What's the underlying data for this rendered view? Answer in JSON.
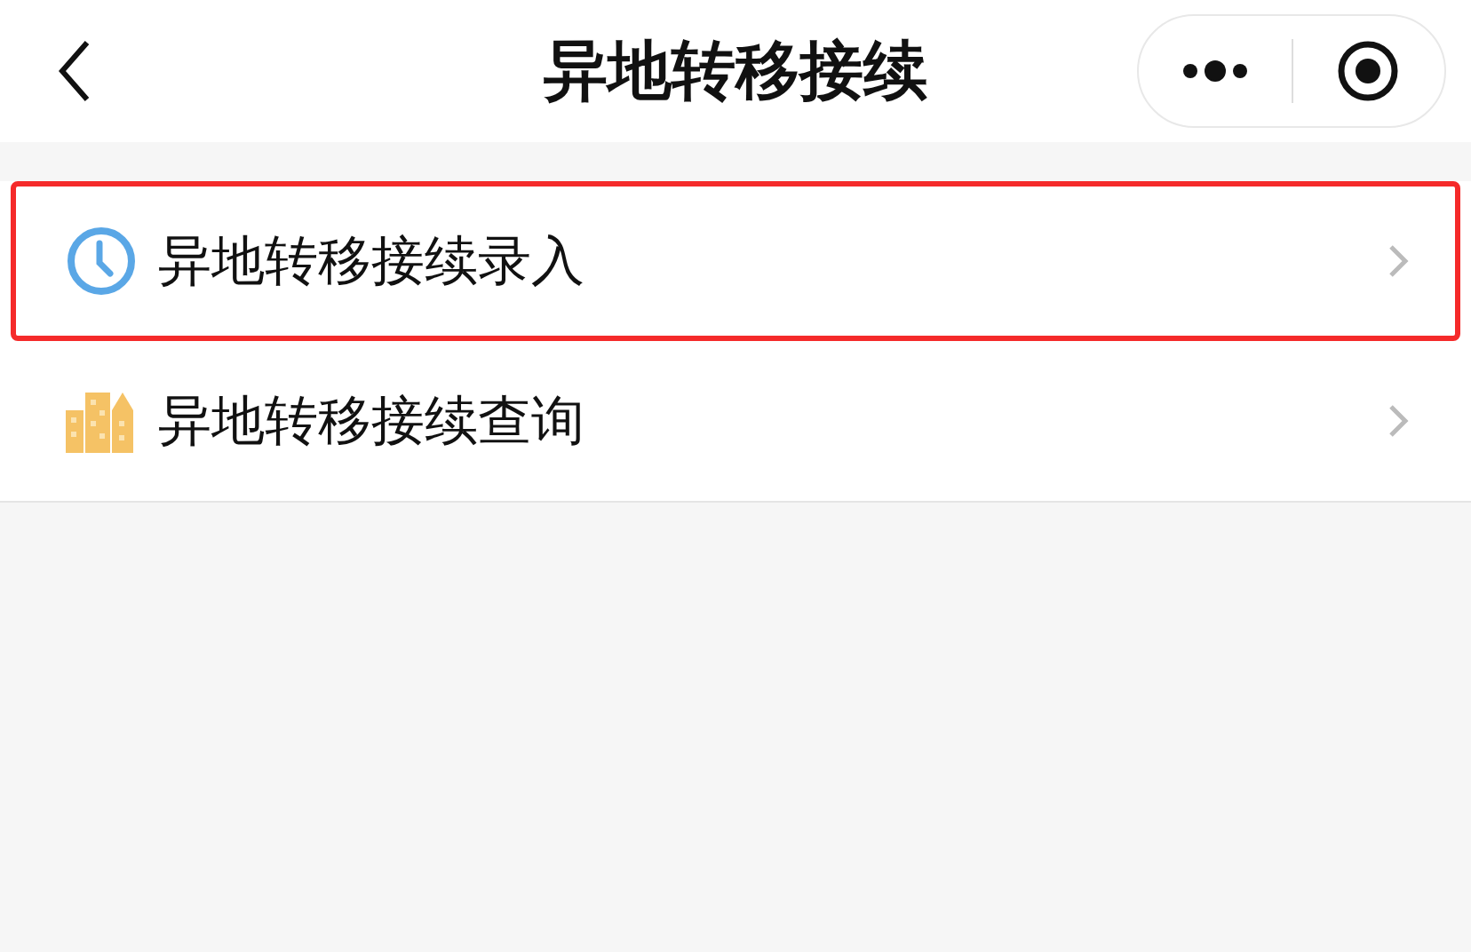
{
  "nav_bar": {
    "title": "异地转移接续"
  },
  "menu": [
    {
      "kind": "clock",
      "label": "异地转移接续录入",
      "highlighted": true
    },
    {
      "kind": "buildings",
      "label": "异地转移接续查询",
      "highlighted": false
    }
  ]
}
